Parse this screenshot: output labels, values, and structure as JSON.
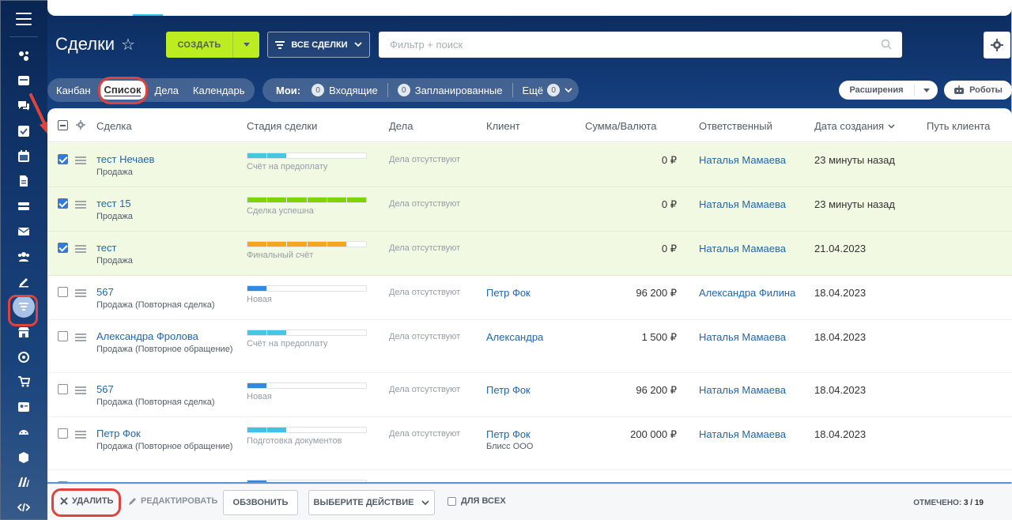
{
  "header": {
    "title": "Сделки",
    "create_label": "СОЗДАТЬ",
    "all_deals_label": "ВСЕ СДЕЛКИ",
    "search_placeholder": "Фильтр + поиск"
  },
  "views": {
    "kanban": "Канбан",
    "list": "Список",
    "activities": "Дела",
    "calendar": "Календарь"
  },
  "my_filters": {
    "label": "Мои:",
    "incoming_count": "0",
    "incoming": "Входящие",
    "planned_count": "0",
    "planned": "Запланированные",
    "more": "Ещё",
    "more_count": "0"
  },
  "toolbar": {
    "extensions": "Расширения",
    "robots": "Роботы"
  },
  "columns": {
    "deal": "Сделка",
    "stage": "Стадия сделки",
    "activities": "Дела",
    "client": "Клиент",
    "amount": "Сумма/Валюта",
    "responsible": "Ответственный",
    "created": "Дата создания",
    "journey": "Путь клиента"
  },
  "colors": {
    "accent_green": "#bbed21",
    "link_blue": "#2067b0",
    "highlight_red": "#e0433c",
    "checked_row_bg": "#f1f9e3"
  },
  "rows": [
    {
      "checked": true,
      "name": "тест Нечаев",
      "type": "Продажа",
      "stage": "Счёт на предоплату",
      "stage_color": "#47c6e1",
      "stage_level": 2,
      "activities": "Дела отсутствуют",
      "client": "",
      "client_sub": "",
      "amount": "0 ₽",
      "responsible": "Наталья Мамаева",
      "created": "23 минуты назад"
    },
    {
      "checked": true,
      "name": "тест 15",
      "type": "Продажа",
      "stage": "Сделка успешна",
      "stage_color": "#7bd500",
      "stage_level": 6,
      "activities": "Дела отсутствуют",
      "client": "",
      "client_sub": "",
      "amount": "0 ₽",
      "responsible": "Наталья Мамаева",
      "created": "23 минуты назад"
    },
    {
      "checked": true,
      "name": "тест",
      "type": "Продажа",
      "stage": "Финальный счёт",
      "stage_color": "#f2a71c",
      "stage_level": 5,
      "activities": "Дела отсутствуют",
      "client": "",
      "client_sub": "",
      "amount": "0 ₽",
      "responsible": "Наталья Мамаева",
      "created": "21.04.2023"
    },
    {
      "checked": false,
      "name": "567",
      "type": "Продажа (Повторная сделка)",
      "stage": "Новая",
      "stage_color": "#2f8ae0",
      "stage_level": 1,
      "activities": "Дела отсутствуют",
      "client": "Петр Фок",
      "client_sub": "",
      "amount": "96 200 ₽",
      "responsible": "Александра Филина",
      "created": "18.04.2023"
    },
    {
      "checked": false,
      "name": "Александра Фролова",
      "type": "Продажа (Повторное обращение)",
      "stage": "Счёт на предоплату",
      "stage_color": "#47c6e1",
      "stage_level": 2,
      "activities": "Дела отсутствуют",
      "client": "Александра",
      "client_sub": "",
      "amount": "1 500 ₽",
      "responsible": "Наталья Мамаева",
      "created": "18.04.2023"
    },
    {
      "checked": false,
      "name": "567",
      "type": "Продажа (Повторная сделка)",
      "stage": "Новая",
      "stage_color": "#2f8ae0",
      "stage_level": 1,
      "activities": "Дела отсутствуют",
      "client": "Петр Фок",
      "client_sub": "",
      "amount": "96 200 ₽",
      "responsible": "Наталья Мамаева",
      "created": "18.04.2023"
    },
    {
      "checked": false,
      "name": "Петр Фок",
      "type": "Продажа (Повторное обращение)",
      "stage": "Подготовка документов",
      "stage_color": "#3fc1e8",
      "stage_level": 2,
      "activities": "Дела отсутствуют",
      "client": "Петр Фок",
      "client_sub": "Блисс ООО",
      "amount": "200 000 ₽",
      "responsible": "Наталья Мамаева",
      "created": "18.04.2023"
    }
  ],
  "actions": {
    "delete": "УДАЛИТЬ",
    "edit": "РЕДАКТИРОВАТЬ",
    "call": "ОБЗВОНИТЬ",
    "choose_action": "ВЫБЕРИТЕ ДЕЙСТВИЕ",
    "for_all": "ДЛЯ ВСЕХ",
    "selected_label": "ОТМЕЧЕНО:",
    "selected_count": "3 / 19"
  }
}
